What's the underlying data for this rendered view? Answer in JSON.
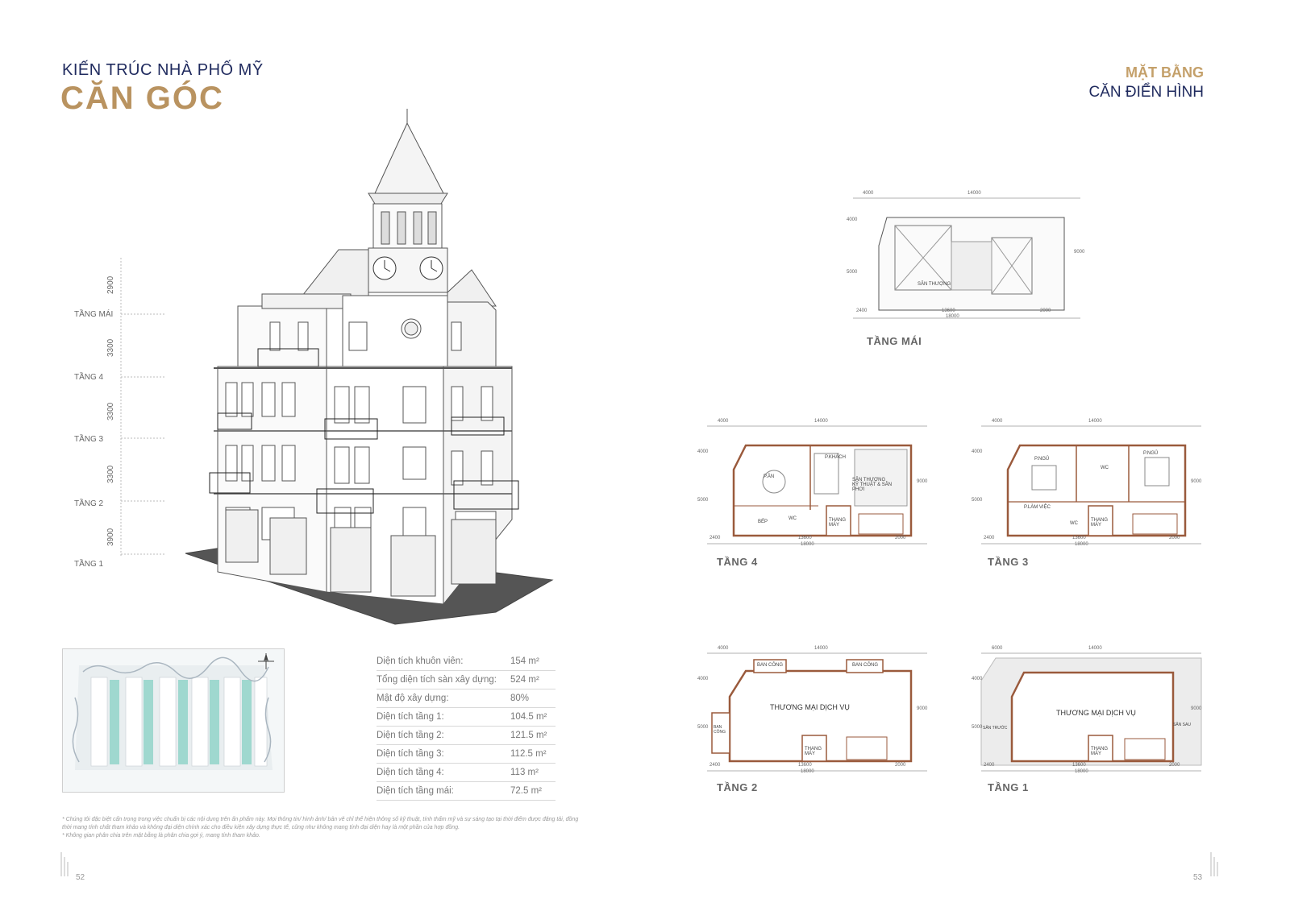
{
  "header": {
    "subtitle": "KIẾN TRÚC NHÀ PHỐ MỸ",
    "title": "CĂN GÓC",
    "right_title_1": "MẶT BẰNG",
    "right_title_2": "CĂN ĐIỂN HÌNH"
  },
  "elevation": {
    "floors": [
      "TẦNG MÁI",
      "TẦNG 4",
      "TẦNG 3",
      "TẦNG 2",
      "TẦNG 1"
    ],
    "heights": [
      "2900",
      "3300",
      "3300",
      "3300",
      "3900"
    ]
  },
  "stats": [
    {
      "label": "Diện tích khuôn viên:",
      "value": "154 m²"
    },
    {
      "label": "Tổng diện tích sàn xây dựng:",
      "value": "524 m²"
    },
    {
      "label": "Mật độ xây dựng:",
      "value": "80%"
    },
    {
      "label": "Diện tích tầng 1:",
      "value": "104.5 m²"
    },
    {
      "label": "Diện tích tầng 2:",
      "value": "121.5 m²"
    },
    {
      "label": "Diện tích tầng 3:",
      "value": "112.5 m²"
    },
    {
      "label": "Diện tích tầng 4:",
      "value": "113 m²"
    },
    {
      "label": "Diện tích tầng mái:",
      "value": "72.5 m²"
    }
  ],
  "notes": [
    "* Chúng tôi đặc biệt cẩn trọng trong việc chuẩn bị các nội dung trên ấn phẩm này. Mọi thông tin/ hình ảnh/ bản vẽ chỉ thể hiện thông số kỹ thuật, tính thẩm mỹ và sự sáng tạo tại thời điểm được đăng tải, đồng thời mang tính chất tham khảo và không đại diện chính xác cho điều kiện xây dựng thực tế, cũng như không mang tính đại diện hay là một phần của hợp đồng.",
    "* Không gian phân chia trên mặt bằng là phân chia gợi ý, mang tính tham khảo."
  ],
  "pages": {
    "left": "52",
    "right": "53"
  },
  "plans": {
    "roof": {
      "caption": "TẦNG MÁI",
      "room": "SÂN THƯỢNG",
      "dims_top": [
        "4000",
        "14000"
      ],
      "dims_bottom": [
        "2400",
        "13600",
        "2000"
      ],
      "dim_total": "18000",
      "dims_left": [
        "4000",
        "5000"
      ],
      "dim_right": "9000"
    },
    "f4": {
      "caption": "TẦNG 4",
      "rooms": [
        "P.ĂN",
        "P.KHÁCH",
        "SÂN THƯỢNG KỸ THUẬT & SÂN PHƠI",
        "BẾP",
        "WC",
        "THANG MÁY"
      ],
      "dims_top": [
        "4000",
        "14000"
      ],
      "dims_bottom": [
        "2400",
        "13600",
        "2000"
      ],
      "dim_total": "18000",
      "dims_left": [
        "4000",
        "5000"
      ],
      "dim_right": "9000"
    },
    "f3": {
      "caption": "TẦNG 3",
      "rooms": [
        "P.NGỦ",
        "WC",
        "P.NGỦ",
        "P.LÀM VIỆC",
        "WC",
        "THANG MÁY"
      ],
      "dims_top": [
        "4000",
        "14000"
      ],
      "dims_bottom": [
        "2400",
        "13600",
        "2000"
      ],
      "dim_total": "18000",
      "dims_left": [
        "4000",
        "5000"
      ],
      "dim_right": "9000"
    },
    "f2": {
      "caption": "TẦNG 2",
      "rooms": [
        "BAN CÔNG",
        "BAN CÔNG",
        "THƯƠNG MẠI DỊCH VỤ",
        "BAN CÔNG",
        "THANG MÁY"
      ],
      "dims_top": [
        "4000",
        "14000"
      ],
      "dims_bottom": [
        "2400",
        "13600",
        "2000"
      ],
      "dim_total": "18000",
      "dims_left": [
        "4000",
        "5000"
      ],
      "dim_right": "9000"
    },
    "f1": {
      "caption": "TẦNG 1",
      "rooms": [
        "THƯƠNG MẠI DỊCH VỤ",
        "SÂN TRƯỚC",
        "SÂN SAU",
        "THANG MÁY"
      ],
      "dims_top": [
        "6000",
        "14000"
      ],
      "dims_bottom": [
        "2400",
        "13600",
        "2000"
      ],
      "dim_total": "18000",
      "dims_left": [
        "4000",
        "5000"
      ],
      "dim_right": "9000"
    }
  }
}
